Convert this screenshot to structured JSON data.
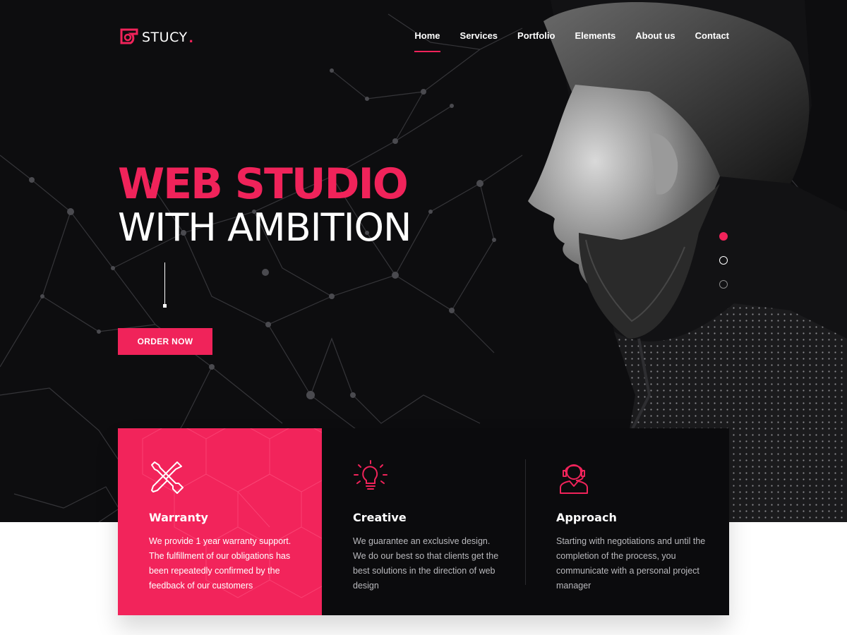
{
  "brand": {
    "name": "STUCY",
    "dot": ".",
    "accent": "#f0235a"
  },
  "nav": {
    "items": [
      {
        "label": "Home",
        "active": true
      },
      {
        "label": "Services",
        "active": false
      },
      {
        "label": "Portfolio",
        "active": false
      },
      {
        "label": "Elements",
        "active": false
      },
      {
        "label": "About us",
        "active": false
      },
      {
        "label": "Contact",
        "active": false
      }
    ]
  },
  "hero": {
    "headline_line1": "WEB STUDIO",
    "headline_line2": "WITH AMBITION",
    "cta_label": "ORDER NOW",
    "slider": {
      "count": 3,
      "active_index": 0
    }
  },
  "features": [
    {
      "icon": "tools-icon",
      "title": "Warranty",
      "text": "We provide 1 year warranty support. The fulfillment of our obligations has been repeatedly confirmed by the feedback of our customers"
    },
    {
      "icon": "lightbulb-icon",
      "title": "Creative",
      "text": "We guarantee an exclusive design. We do our best so that clients get the best solutions in the direction of web design"
    },
    {
      "icon": "headset-user-icon",
      "title": "Approach",
      "text": "Starting with negotiations and until the completion of the process, you communicate with a personal project manager"
    }
  ]
}
